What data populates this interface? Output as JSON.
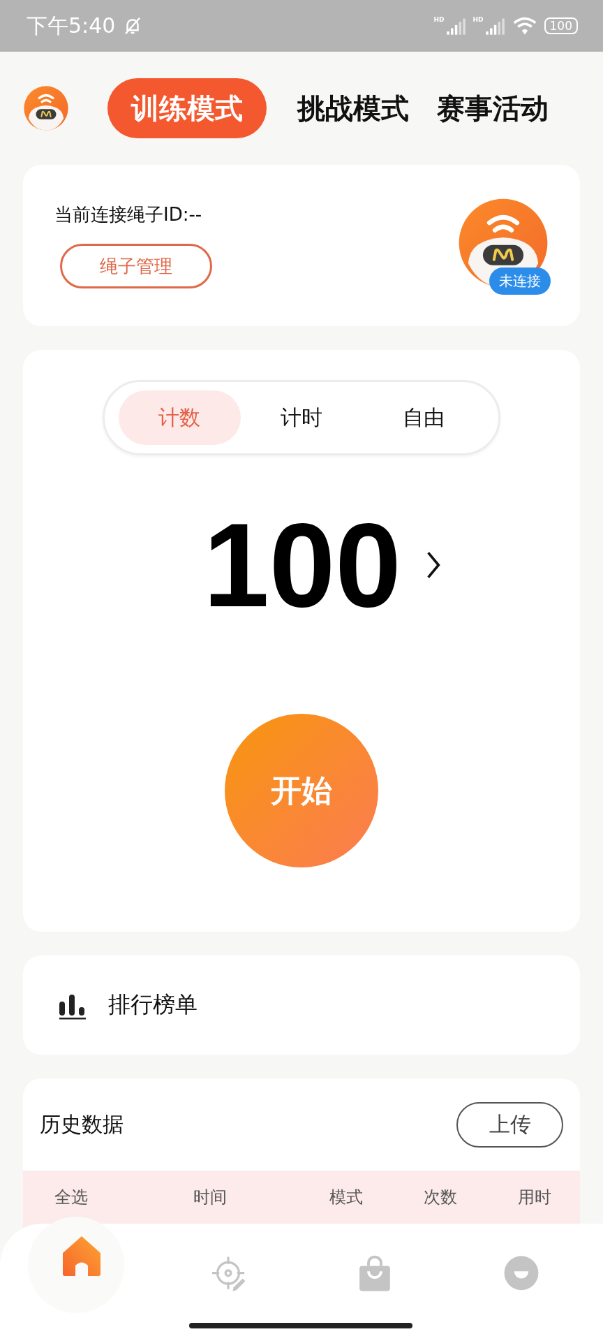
{
  "status_bar": {
    "time": "下午5:40",
    "signals": [
      {
        "label": "HD"
      },
      {
        "label": "HD"
      }
    ],
    "battery": "100"
  },
  "top_tabs": [
    {
      "label": "训练模式",
      "selected": true
    },
    {
      "label": "挑战模式",
      "selected": false
    },
    {
      "label": "赛事活动",
      "selected": false
    }
  ],
  "rope_card": {
    "connection_label": "当前连接绳子ID:--",
    "manage_button": "绳子管理",
    "status_badge": "未连接"
  },
  "training": {
    "modes": [
      {
        "label": "计数",
        "selected": true
      },
      {
        "label": "计时",
        "selected": false
      },
      {
        "label": "自由",
        "selected": false
      }
    ],
    "target": "100",
    "start_button": "开始"
  },
  "leaderboard": {
    "label": "排行榜单"
  },
  "history": {
    "title": "历史数据",
    "upload_button": "上传",
    "columns": [
      "全选",
      "时间",
      "模式",
      "次数",
      "用时"
    ]
  },
  "bottom_nav": [
    {
      "kind": "home",
      "selected": true
    },
    {
      "kind": "target",
      "selected": false
    },
    {
      "kind": "shop",
      "selected": false
    },
    {
      "kind": "profile",
      "selected": false
    }
  ]
}
